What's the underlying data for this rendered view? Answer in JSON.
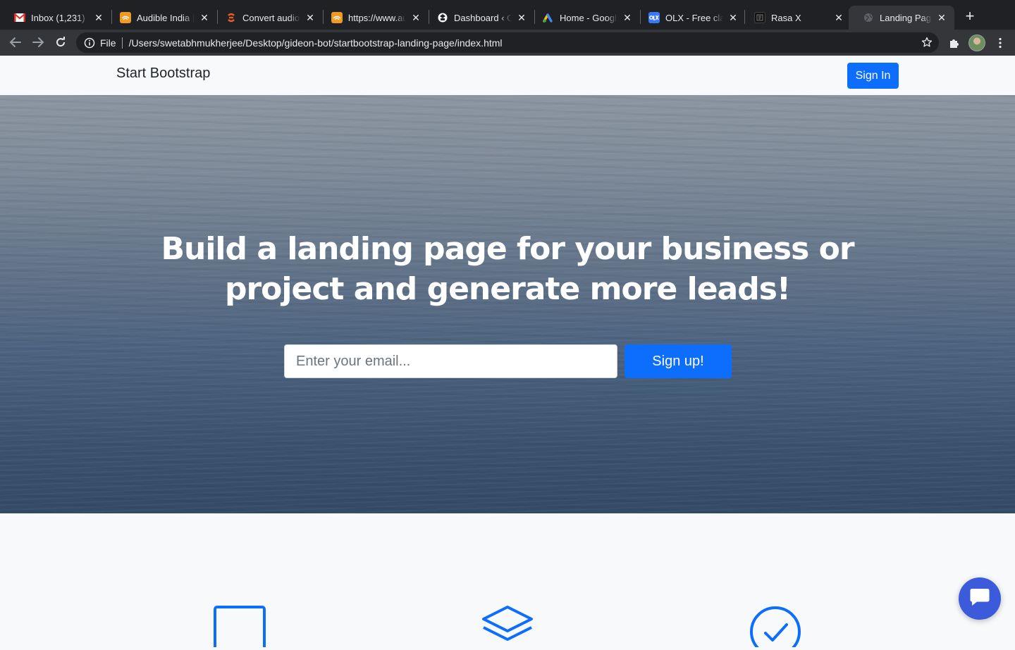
{
  "browser": {
    "tabs": [
      {
        "title": "Inbox (1,231) - ",
        "favicon": "gmail-icon",
        "color": "#d93025"
      },
      {
        "title": "Audible India | ",
        "favicon": "audible-icon",
        "color": "#f29a1f"
      },
      {
        "title": "Convert audio ",
        "favicon": "convert-icon",
        "color": "#ea5b25"
      },
      {
        "title": "https://www.au",
        "favicon": "audible-icon",
        "color": "#f29a1f"
      },
      {
        "title": "Dashboard ‹ G",
        "favicon": "dashboard-icon",
        "color": "#ffffff"
      },
      {
        "title": "Home - Google",
        "favicon": "google-ads-icon",
        "color": "#fbbc04"
      },
      {
        "title": "OLX - Free clas",
        "favicon": "olx-icon",
        "color": "#3a77ff"
      },
      {
        "title": "Rasa X",
        "favicon": "rasa-icon",
        "color": "#111111"
      },
      {
        "title": "Landing Page - ",
        "favicon": "globe-icon",
        "color": "#5f6368",
        "active": true
      }
    ],
    "address_bar": {
      "scheme": "File",
      "url": "/Users/swetabhmukherjee/Desktop/gideon-bot/startbootstrap-landing-page/index.html"
    }
  },
  "page": {
    "navbar": {
      "brand": "Start Bootstrap",
      "signin_label": "Sign In"
    },
    "hero": {
      "title": "Build a landing page for your business or project and generate more leads!",
      "email_placeholder": "Enter your email...",
      "signup_label": "Sign up!"
    },
    "features": {
      "icons": [
        "window-icon",
        "layers-icon",
        "check-circle-icon"
      ]
    },
    "colors": {
      "primary": "#0d6efd",
      "chat_fab": "#3b5bdb"
    }
  }
}
